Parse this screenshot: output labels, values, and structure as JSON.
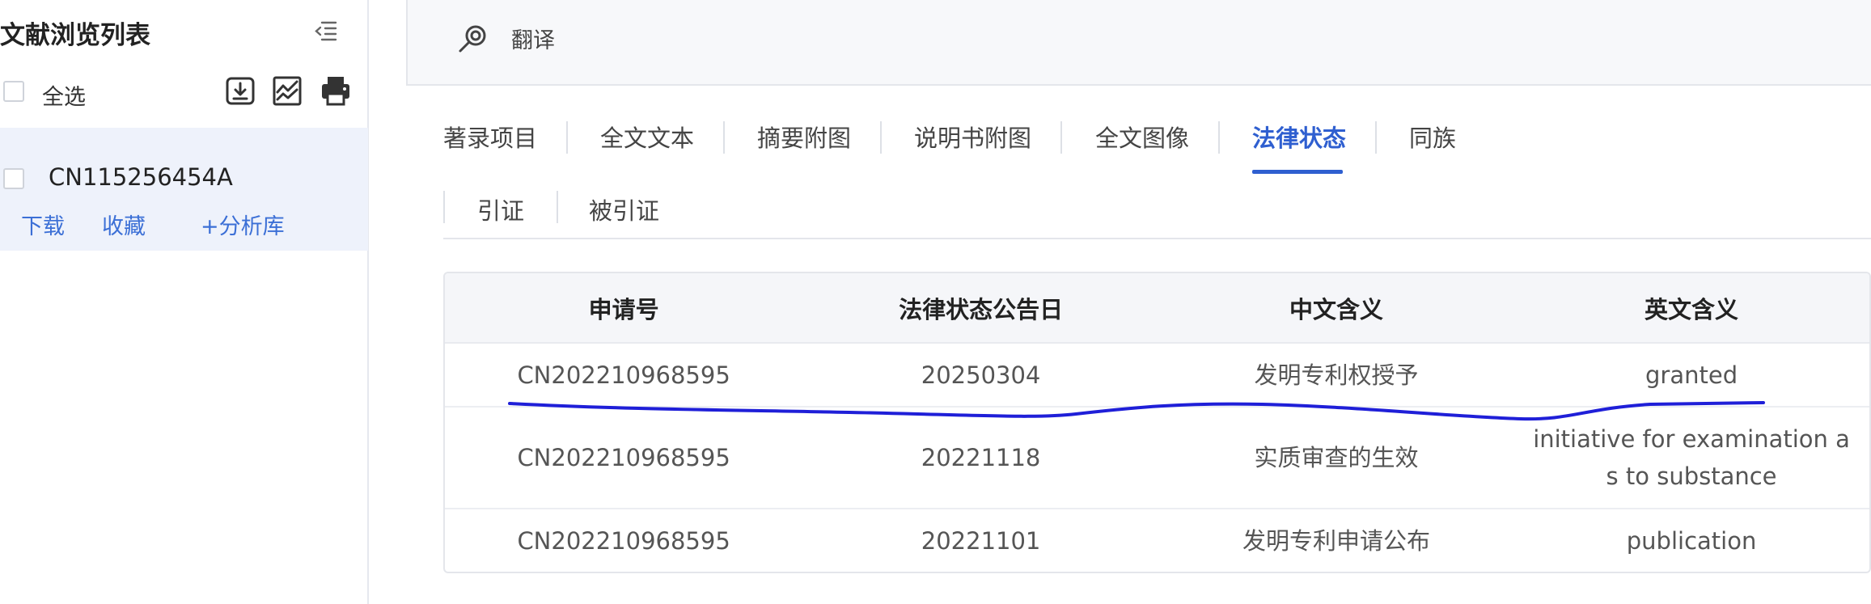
{
  "sidebar": {
    "title": "文献浏览列表",
    "select_all_label": "全选",
    "toolbar_icons": [
      "download-icon",
      "chart-icon",
      "print-icon"
    ],
    "documents": [
      {
        "number": "CN115256454A",
        "actions": {
          "download": "下载",
          "favorite": "收藏",
          "add_analysis": "+分析库"
        }
      }
    ]
  },
  "topbar": {
    "translate_label": "翻译"
  },
  "tabs": [
    {
      "label": "著录项目"
    },
    {
      "label": "全文文本"
    },
    {
      "label": "摘要附图"
    },
    {
      "label": "说明书附图"
    },
    {
      "label": "全文图像"
    },
    {
      "label": "法律状态",
      "active": true
    },
    {
      "label": "同族"
    }
  ],
  "subtabs": [
    {
      "label": "引证"
    },
    {
      "label": "被引证"
    }
  ],
  "legal_table": {
    "headers": [
      "申请号",
      "法律状态公告日",
      "中文含义",
      "英文含义"
    ],
    "rows": [
      [
        "CN202210968595",
        "20250304",
        "发明专利权授予",
        "granted"
      ],
      [
        "CN202210968595",
        "20221118",
        "实质审查的生效",
        "initiative for examination as to substance"
      ],
      [
        "CN202210968595",
        "20221101",
        "发明专利申请公布",
        "publication"
      ]
    ]
  },
  "colors": {
    "accent": "#2f5fd0",
    "link": "#3b6fd6",
    "annotation_stroke": "#1f1fd8",
    "selected_item_bg": "#eef2fb"
  }
}
